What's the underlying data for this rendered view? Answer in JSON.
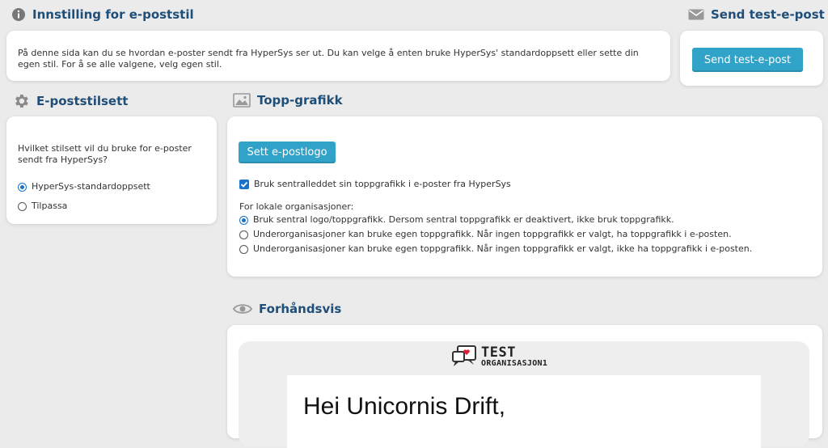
{
  "header": {
    "title": "Innstilling for e-poststil",
    "description": "På denne sida kan du se hvordan e-poster sendt fra HyperSys ser ut. Du kan velge å enten bruke HyperSys' standardoppsett eller sette din egen stil. For å se alle valgene, velg egen stil."
  },
  "test_email": {
    "title": "Send test-e-post",
    "button_label": "Send test-e-post"
  },
  "style_set": {
    "title": "E-poststilsett",
    "question": "Hvilket stilsett vil du bruke for e-poster sendt fra HyperSys?",
    "options": [
      {
        "label": "HyperSys-standardoppsett",
        "selected": true
      },
      {
        "label": "Tilpassa",
        "selected": false
      }
    ]
  },
  "top_graphic": {
    "title": "Topp-grafikk",
    "logo_button_label": "Sett e-postlogo",
    "central_checkbox_label": "Bruk sentralleddet sin toppgrafikk i e-poster fra HyperSys",
    "central_checkbox_checked": true,
    "local_heading": "For lokale organisasjoner:",
    "local_options": [
      {
        "label": "Bruk sentral logo/toppgrafikk. Dersom sentral toppgrafikk er deaktivert, ikke bruk toppgrafikk.",
        "selected": true
      },
      {
        "label": "Underorganisasjoner kan bruke egen toppgrafikk. Når ingen toppgrafikk er valgt, ha toppgrafikk i e-posten.",
        "selected": false
      },
      {
        "label": "Underorganisasjoner kan bruke egen toppgrafikk. Når ingen toppgrafikk er valgt, ikke ha toppgrafikk i e-posten.",
        "selected": false
      }
    ]
  },
  "preview": {
    "title": "Forhåndsvis",
    "logo_line1": "TEST",
    "logo_line2": "ORGANISASJON1",
    "greeting": "Hei Unicornis Drift,"
  },
  "colors": {
    "accent": "#31a2c8",
    "heading": "#1f4e79",
    "background": "#ebebeb"
  }
}
